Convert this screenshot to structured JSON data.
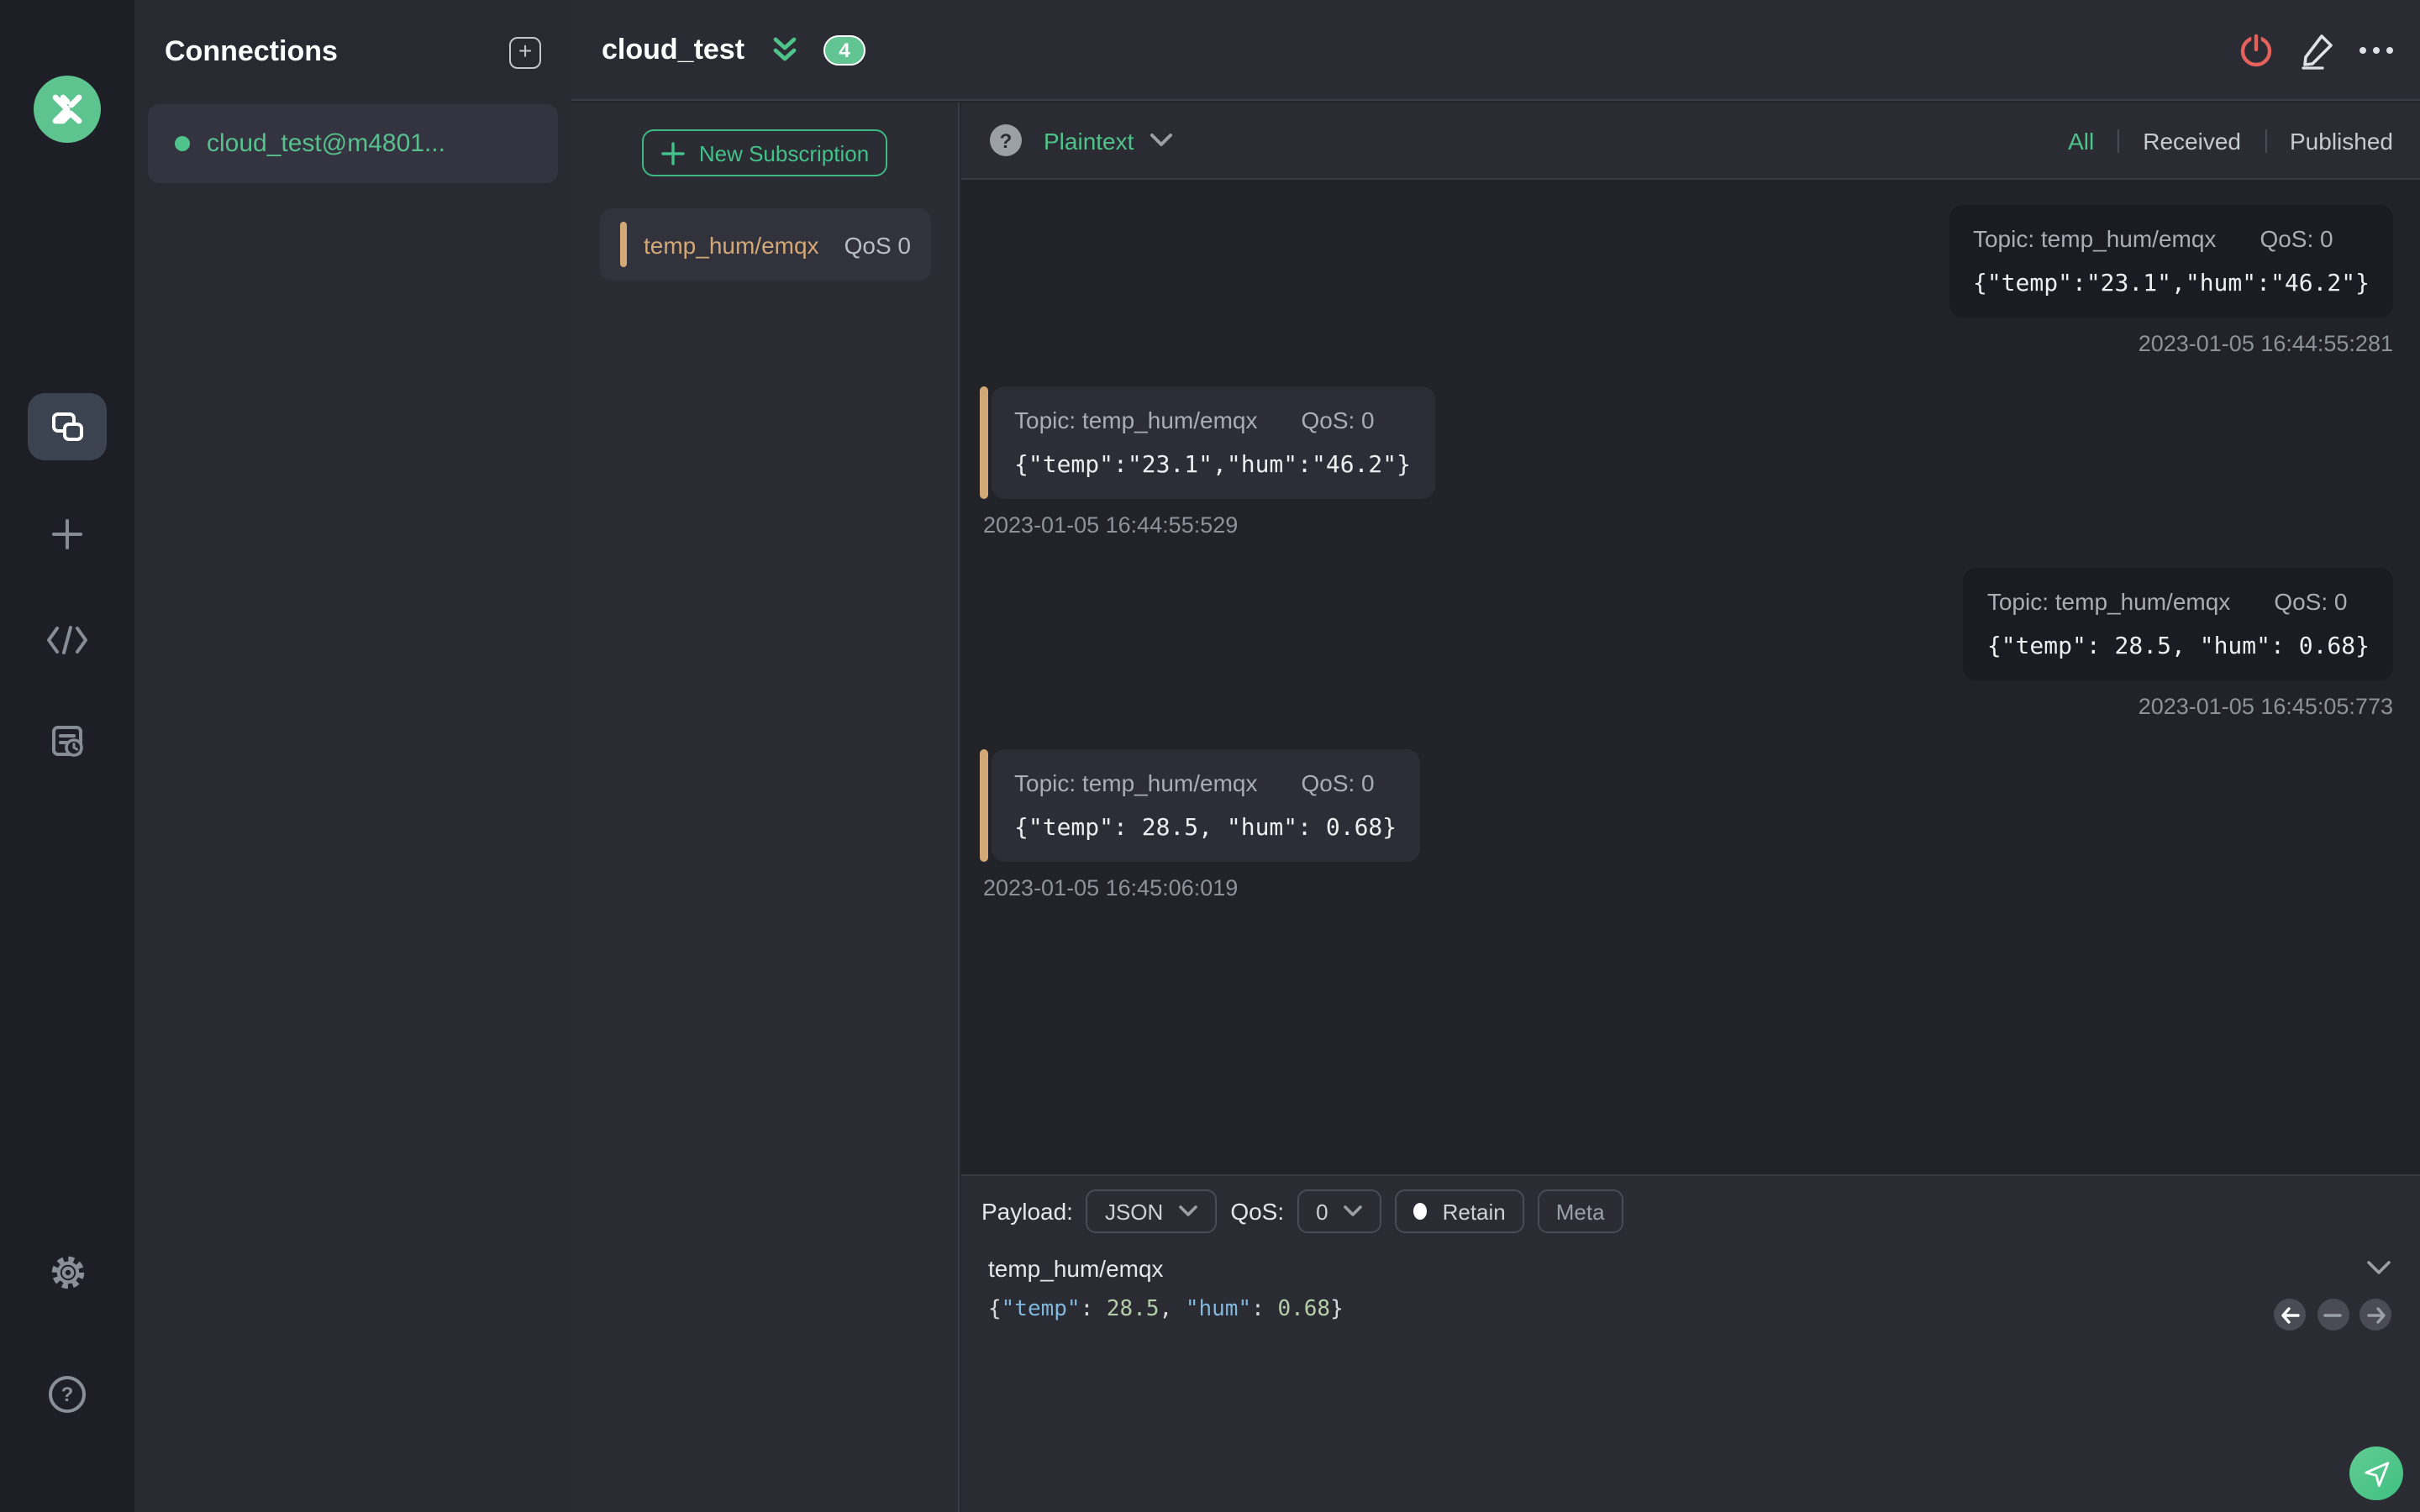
{
  "colors": {
    "accent_green": "#4fc38a",
    "topic_tan": "#d3a877",
    "power_red": "#e5625c",
    "badge_green": "#62c493",
    "published_bubble": "#1b1c23",
    "received_bubble": "#2c2d36"
  },
  "sidebar": {
    "help_glyph": "?"
  },
  "connections_panel": {
    "title": "Connections",
    "add_glyph": "+",
    "items": [
      {
        "name": "cloud_test@m4801...",
        "connected": true
      }
    ]
  },
  "header": {
    "title": "cloud_test",
    "badge_count": "4"
  },
  "subscriptions": {
    "new_button_label": "New Subscription",
    "items": [
      {
        "topic": "temp_hum/emqx",
        "qos": "QoS 0"
      }
    ]
  },
  "toolbar": {
    "help_glyph": "?",
    "format_value": "Plaintext",
    "filters": [
      {
        "label": "All",
        "active": true
      },
      {
        "label": "Received",
        "active": false
      },
      {
        "label": "Published",
        "active": false
      }
    ]
  },
  "messages": [
    {
      "direction": "published",
      "topic_label": "Topic: temp_hum/emqx",
      "qos_label": "QoS: 0",
      "payload": "{\"temp\":\"23.1\",\"hum\":\"46.2\"}",
      "timestamp": "2023-01-05 16:44:55:281"
    },
    {
      "direction": "received",
      "topic_label": "Topic: temp_hum/emqx",
      "qos_label": "QoS: 0",
      "payload": "{\"temp\":\"23.1\",\"hum\":\"46.2\"}",
      "timestamp": "2023-01-05 16:44:55:529"
    },
    {
      "direction": "published",
      "topic_label": "Topic: temp_hum/emqx",
      "qos_label": "QoS: 0",
      "payload": "{\"temp\": 28.5, \"hum\": 0.68}",
      "timestamp": "2023-01-05 16:45:05:773"
    },
    {
      "direction": "received",
      "topic_label": "Topic: temp_hum/emqx",
      "qos_label": "QoS: 0",
      "payload": "{\"temp\": 28.5, \"hum\": 0.68}",
      "timestamp": "2023-01-05 16:45:06:019"
    }
  ],
  "publish": {
    "payload_label": "Payload:",
    "format_value": "JSON",
    "qos_label": "QoS:",
    "qos_value": "0",
    "retain_label": "Retain",
    "meta_label": "Meta",
    "topic_value": "temp_hum/emqx",
    "editor": {
      "open": "{",
      "key1": "\"temp\"",
      "colon1": ": ",
      "num1": "28.5",
      "comma": ", ",
      "key2": "\"hum\"",
      "colon2": ": ",
      "num2": "0.68",
      "close": "}"
    }
  }
}
